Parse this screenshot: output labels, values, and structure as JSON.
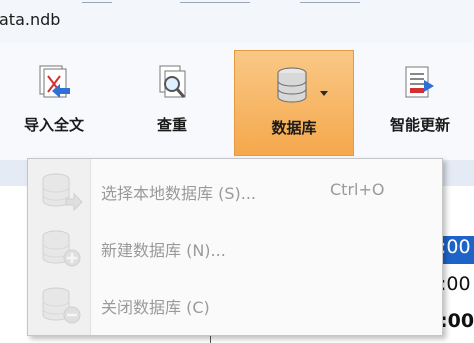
{
  "window": {
    "title": "ata.ndb"
  },
  "ribbon": {
    "buttons": [
      {
        "label": "导入全文",
        "icon": "import-fulltext-icon"
      },
      {
        "label": "查重",
        "icon": "duplicate-check-icon"
      },
      {
        "label": "数据库",
        "icon": "database-icon",
        "active": true
      },
      {
        "label": "智能更新",
        "icon": "smart-update-icon"
      }
    ]
  },
  "menu": {
    "items": [
      {
        "label": "选择本地数据库 (S)...",
        "shortcut": "Ctrl+O",
        "icon": "database-open-icon",
        "enabled": false
      },
      {
        "label": "新建数据库 (N)...",
        "shortcut": "",
        "icon": "database-add-icon",
        "enabled": false
      },
      {
        "label": "关闭数据库 (C)",
        "shortcut": "",
        "icon": "database-close-icon",
        "enabled": false
      }
    ]
  },
  "background": {
    "cells": [
      ":00",
      ":00",
      ":00"
    ]
  },
  "colors": {
    "active_button": "#f5a84c",
    "selection": "#1e64c8"
  }
}
